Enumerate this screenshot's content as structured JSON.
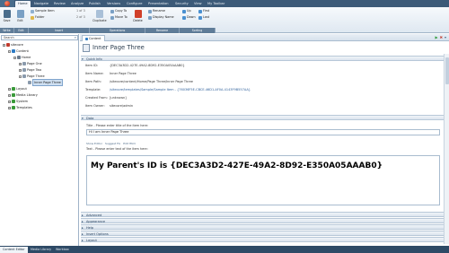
{
  "ribbon": {
    "tabs": [
      "Home",
      "Navigate",
      "Review",
      "Analyze",
      "Publish",
      "Versions",
      "Configure",
      "Presentation",
      "Security",
      "View",
      "My Toolbar"
    ],
    "active_tab": "Home",
    "groups": [
      "Write",
      "Edit",
      "Insert",
      "Operations",
      "Rename",
      "Sorting"
    ],
    "buttons": {
      "save": "Save",
      "edit": "Edit",
      "sample_item": "Sample Item",
      "folder": "Folder",
      "insert_count_1": "1 of 3",
      "insert_count_2": "2 of 3",
      "duplicate": "Duplicate",
      "copy_to": "Copy To",
      "move_to": "Move To",
      "delete": "Delete",
      "rename": "Rename",
      "display_name": "Display Name",
      "up": "Up",
      "down": "Down",
      "first": "First",
      "last": "Last"
    }
  },
  "tree": {
    "search_placeholder": "Search",
    "items": [
      {
        "label": "sitecore",
        "indent": 0,
        "exp": "–",
        "color": "#c0392b"
      },
      {
        "label": "Content",
        "indent": 1,
        "exp": "–",
        "color": "#2d7bc4"
      },
      {
        "label": "Home",
        "indent": 2,
        "exp": "–",
        "color": "#6b7b8c"
      },
      {
        "label": "Page One",
        "indent": 3,
        "exp": "+",
        "color": "#8a9aac"
      },
      {
        "label": "Page Two",
        "indent": 3,
        "exp": "+",
        "color": "#8a9aac"
      },
      {
        "label": "Page Three",
        "indent": 3,
        "exp": "–",
        "color": "#8a9aac"
      },
      {
        "label": "Inner Page Three",
        "indent": 4,
        "exp": "",
        "color": "#8a9aac",
        "selected": true
      },
      {
        "label": "Layout",
        "indent": 1,
        "exp": "+",
        "color": "#3a9a3a"
      },
      {
        "label": "Media Library",
        "indent": 1,
        "exp": "+",
        "color": "#3a9a3a"
      },
      {
        "label": "System",
        "indent": 1,
        "exp": "+",
        "color": "#3a9a3a"
      },
      {
        "label": "Templates",
        "indent": 1,
        "exp": "+",
        "color": "#3a9a3a"
      }
    ]
  },
  "content": {
    "tab_label": "Content",
    "item_title": "Inner Page Three",
    "quick_info": {
      "header": "Quick Info",
      "rows": [
        {
          "label": "Item ID:",
          "value": "{DEC3A3D2-427E-49A2-8D92-E350A05AAAB0}"
        },
        {
          "label": "Item Name:",
          "value": "Inner Page Three"
        },
        {
          "label": "Item Path:",
          "value": "/sitecore/content/Home/Page Three/Inner Page Three"
        },
        {
          "label": "Template:",
          "value": "/sitecore/templates/Sample/Sample Item - {76036F5E-CBCE-46D1-AF0A-4143F9B557AA}"
        },
        {
          "label": "Created From:",
          "value": "[unknown]"
        },
        {
          "label": "Item Owner:",
          "value": "sitecore\\admin"
        }
      ]
    },
    "data_section": {
      "header": "Data",
      "title_field_label": "Title - Please enter title of the item here:",
      "title_field_value": "Hi I am Inner Page Three",
      "editor_links": [
        "Show Editor",
        "Suggest Fix",
        "Edit Html"
      ],
      "text_field_label": "Text - Please enter text of the item here:",
      "text_field_value": "My Parent's ID is {DEC3A3D2-427E-49A2-8D92-E350A05AAAB0}"
    },
    "collapsed_sections": [
      "Advanced",
      "Appearance",
      "Help",
      "Insert Options",
      "Layout"
    ]
  },
  "bottom_tabs": [
    "Content Editor",
    "Media Library",
    "Workbox"
  ],
  "colors": {
    "ribbon_dark": "#3c5a78",
    "accent_red": "#c0392b",
    "accent_green": "#3a9a3a"
  }
}
